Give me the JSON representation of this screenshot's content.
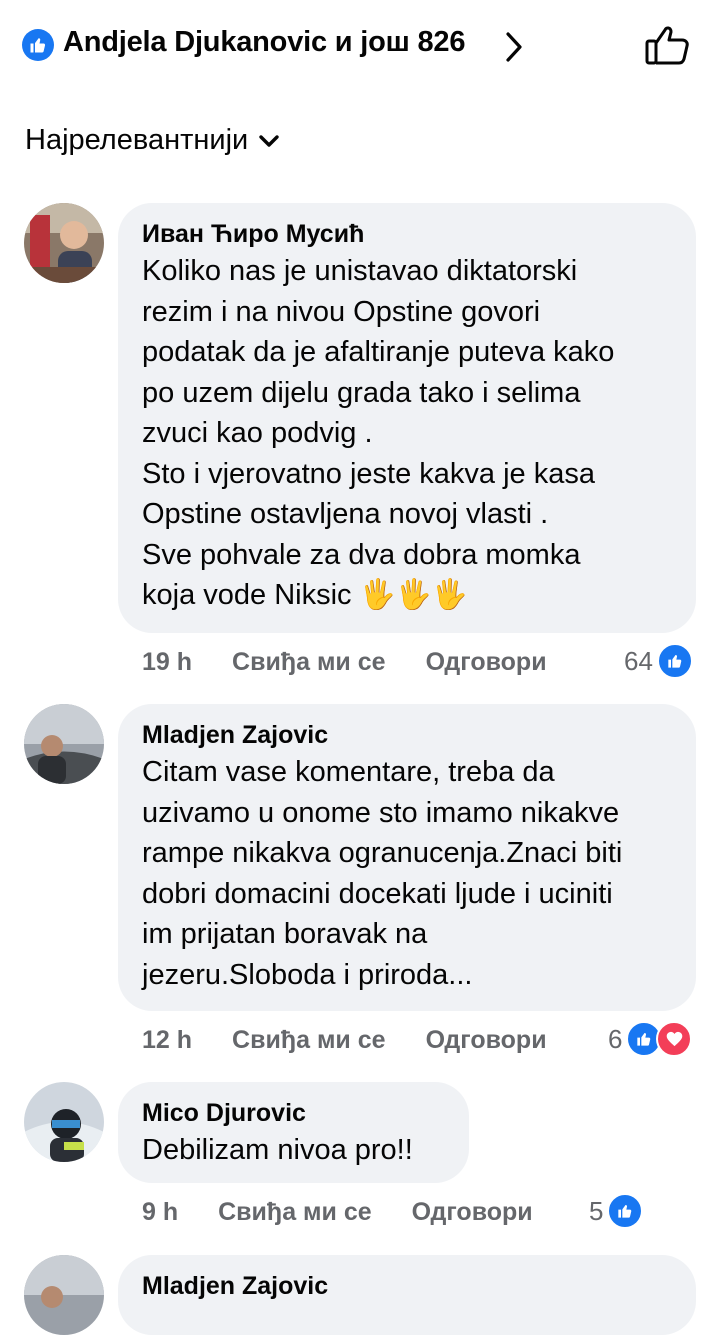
{
  "header": {
    "reactors": "Andjela Djukanovic и још 826",
    "like_icon": "like-icon",
    "chevron_icon": "chevron-right-icon",
    "thumb_icon": "thumbs-up-outline-icon"
  },
  "sort": {
    "label": "Најрелевантнији",
    "icon": "chevron-down-icon"
  },
  "actions": {
    "like": "Свиђа ми се",
    "reply": "Одговори"
  },
  "colors": {
    "accent": "#1877f2",
    "love": "#f33e58",
    "bubble": "#f0f2f5",
    "meta": "#65676b"
  },
  "comments": [
    {
      "author": "Иван Ћиро Мусић",
      "text": "Koliko nas je unistavao diktatorski\nrezim i na nivou Opstine govori\npodatak da je afaltiranje puteva kako\npo uzem dijelu grada tako i selima\nzvuci kao podvig .\nSto i vjerovatno jeste kakva je kasa\nOpstine ostavljena novoj vlasti .\nSve pohvale za dva dobra momka\nkoja vode Niksic",
      "emoji": "🖐🖐🖐",
      "time": "19 h",
      "reactions": "64",
      "reaction_types": [
        "like"
      ]
    },
    {
      "author": "Mladjen Zajovic",
      "text": "Citam vase komentare, treba da\nuzivamo u onome sto imamo nikakve\nrampe nikakva ogranucenja.Znaci biti\ndobri domacini docekati ljude i uciniti\nim prijatan boravak na\njezeru.Sloboda i priroda...",
      "time": "12 h",
      "reactions": "6",
      "reaction_types": [
        "like",
        "love"
      ]
    },
    {
      "author": "Mico Djurovic",
      "text": "Debilizam nivoa pro!!",
      "time": "9 h",
      "reactions": "5",
      "reaction_types": [
        "like"
      ]
    },
    {
      "author": "Mladjen Zajovic",
      "text": ""
    }
  ]
}
